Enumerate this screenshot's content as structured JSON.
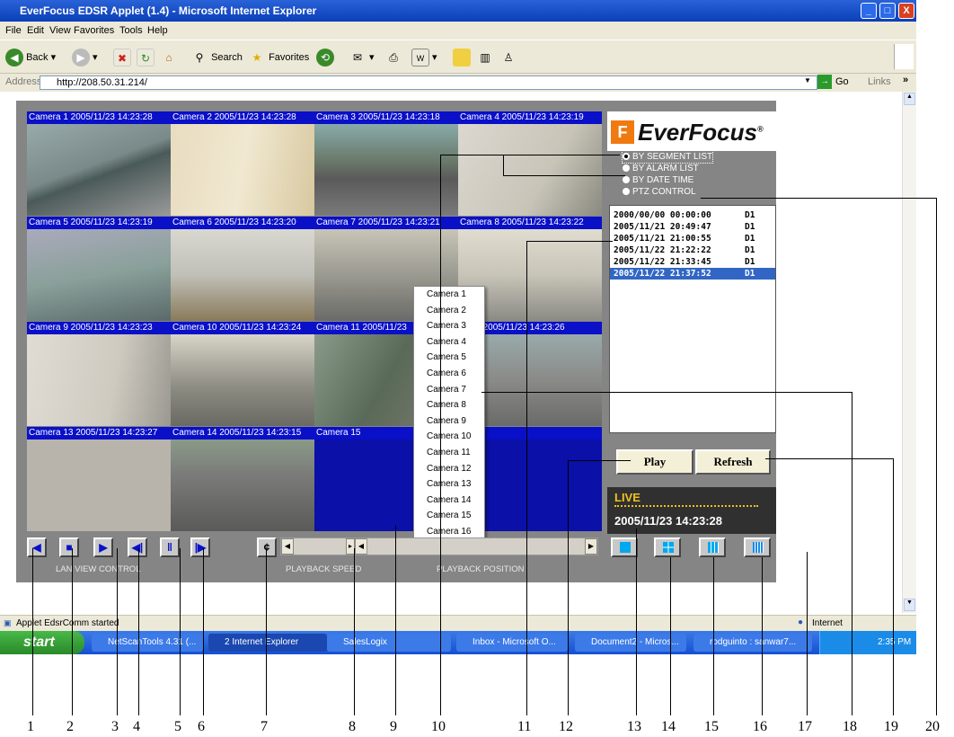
{
  "window": {
    "title": "EverFocus EDSR Applet (1.4) - Microsoft Internet Explorer",
    "min": "_",
    "max": "□",
    "close": "X"
  },
  "menu": [
    "File",
    "Edit",
    "View",
    "Favorites",
    "Tools",
    "Help"
  ],
  "toolbar": {
    "back": "Back",
    "search": "Search",
    "favorites": "Favorites"
  },
  "address": {
    "label": "Address",
    "url": "http://208.50.31.214/",
    "go": "Go",
    "links": "Links"
  },
  "cameras": [
    {
      "label": "Camera 1 2005/11/23 14:23:28"
    },
    {
      "label": "Camera 2 2005/11/23 14:23:28"
    },
    {
      "label": "Camera 3 2005/11/23 14:23:18"
    },
    {
      "label": "Camera 4 2005/11/23 14:23:19"
    },
    {
      "label": "Camera 5 2005/11/23 14:23:19"
    },
    {
      "label": "Camera 6 2005/11/23 14:23:20"
    },
    {
      "label": "Camera 7 2005/11/23 14:23:21"
    },
    {
      "label": "Camera 8 2005/11/23 14:23:22"
    },
    {
      "label": "Camera 9 2005/11/23 14:23:23"
    },
    {
      "label": "Camera 10 2005/11/23 14:23:24"
    },
    {
      "label": "Camera 11 2005/11/23"
    },
    {
      "label": "ra 12 2005/11/23 14:23:26"
    },
    {
      "label": "Camera 13 2005/11/23 14:23:27"
    },
    {
      "label": "Camera 14 2005/11/23 14:23:15"
    },
    {
      "label": "Camera 15"
    },
    {
      "label": "ra 16"
    }
  ],
  "context_menu": [
    "Camera 1",
    "Camera 2",
    "Camera 3",
    "Camera 4",
    "Camera 5",
    "Camera 6",
    "Camera 7",
    "Camera 8",
    "Camera 9",
    "Camera 10",
    "Camera 11",
    "Camera 12",
    "Camera 13",
    "Camera 14",
    "Camera 15",
    "Camera 16"
  ],
  "logo": {
    "mark": "F",
    "word": "EverFocus",
    "reg": "®"
  },
  "modes": [
    {
      "label": "BY SEGMENT LIST",
      "selected": true
    },
    {
      "label": "BY ALARM LIST",
      "selected": false
    },
    {
      "label": "BY DATE TIME",
      "selected": false
    },
    {
      "label": "PTZ CONTROL",
      "selected": false
    }
  ],
  "segments": [
    {
      "time": "2000/00/00 00:00:00",
      "ch": "D1"
    },
    {
      "time": "2005/11/21 20:49:47",
      "ch": "D1"
    },
    {
      "time": "2005/11/21 21:00:55",
      "ch": "D1"
    },
    {
      "time": "2005/11/22 21:22:22",
      "ch": "D1"
    },
    {
      "time": "2005/11/22 21:33:45",
      "ch": "D1"
    },
    {
      "time": "2005/11/22 21:37:52",
      "ch": "D1"
    }
  ],
  "buttons": {
    "play": "Play",
    "refresh": "Refresh"
  },
  "live": {
    "status": "LIVE",
    "datetime": "2005/11/23 14:23:28"
  },
  "controls": {
    "lan_view": "LAN VIEW CONTROL",
    "playback_speed": "PLAYBACK SPEED",
    "playback_position": "PLAYBACK POSITION"
  },
  "status": {
    "text": "Applet EdsrComm started",
    "zone": "Internet"
  },
  "taskbar": {
    "start": "start",
    "tasks": [
      "NetScanTools 4.31 (...",
      "2 Internet Explorer",
      "SalesLogix",
      "Inbox - Microsoft O...",
      "Document2 - Micros...",
      "rodguinto : sanwar7..."
    ],
    "clock": "2:35 PM"
  },
  "callouts": [
    "1",
    "2",
    "3",
    "4",
    "5",
    "6",
    "7",
    "8",
    "9",
    "10",
    "11",
    "12",
    "13",
    "14",
    "15",
    "16",
    "17",
    "18",
    "19",
    "20"
  ]
}
